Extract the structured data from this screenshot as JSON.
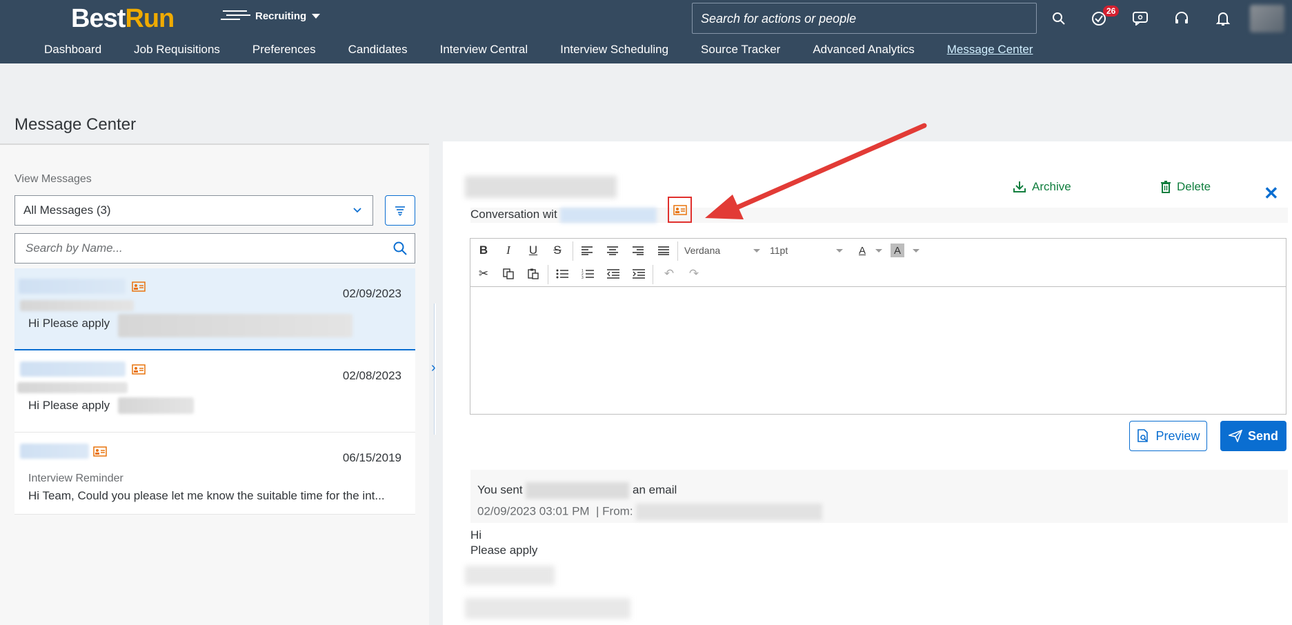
{
  "header": {
    "logo_best": "Best",
    "logo_run": "Run",
    "module": "Recruiting",
    "search_placeholder": "Search for actions or people",
    "todo_badge": "26"
  },
  "nav": {
    "items": [
      "Dashboard",
      "Job Requisitions",
      "Preferences",
      "Candidates",
      "Interview Central",
      "Interview Scheduling",
      "Source Tracker",
      "Advanced Analytics",
      "Message Center"
    ],
    "active": "Message Center"
  },
  "page": {
    "title": "Message Center"
  },
  "left": {
    "view_label": "View Messages",
    "select_value": "All Messages (3)",
    "search_placeholder": "Search by Name...",
    "messages": [
      {
        "date": "02/09/2023",
        "preview": "Hi  Please apply"
      },
      {
        "date": "02/08/2023",
        "preview": "Hi  Please apply"
      },
      {
        "date": "06/15/2019",
        "subject": "Interview Reminder",
        "preview": "Hi Team,  Could you please let me know the suitable time for the int..."
      }
    ]
  },
  "right": {
    "conversation_prefix": "Conversation wit",
    "archive_label": "Archive",
    "delete_label": "Delete",
    "toolbar": {
      "font": "Verdana",
      "size": "11pt"
    },
    "preview_label": "Preview",
    "send_label": "Send",
    "sent_prefix": "You sent",
    "sent_suffix": "an email",
    "sent_datetime": "02/09/2023 03:01 PM",
    "from_label": "| From:",
    "body_line1": "Hi",
    "body_line2": "Please apply"
  },
  "colors": {
    "shell": "#354a5f",
    "accent": "#0a6ed1",
    "archive_green": "#107e3e",
    "highlight_red": "#e0302d",
    "logo_run": "#f0ab00"
  }
}
